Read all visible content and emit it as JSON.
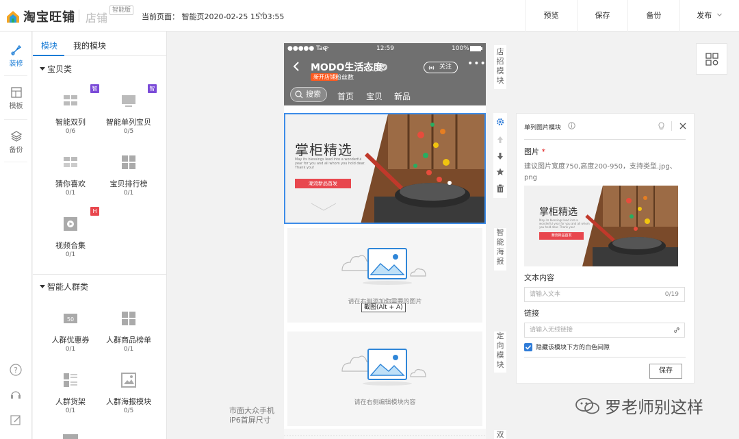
{
  "header": {
    "logo_text": "淘宝旺铺",
    "shop_text": "店铺",
    "edition_tag": "智能版",
    "current_page": "当前页面： 智能页2020-02-25 15:03:55",
    "preview_label": "预览",
    "save_label": "保存",
    "backup_label": "备份",
    "publish_label": "发布"
  },
  "left_nav": {
    "items": [
      {
        "label": "装修",
        "icon": "brush-icon",
        "active": true
      },
      {
        "label": "模板",
        "icon": "template-icon"
      },
      {
        "label": "备份",
        "icon": "layers-icon"
      }
    ]
  },
  "module_panel": {
    "tabs": [
      "模块",
      "我的模块"
    ],
    "active_tab": "模块",
    "sections": [
      {
        "title": "宝贝类",
        "modules": [
          {
            "name": "智能双列",
            "count": "0/6",
            "badge": "智"
          },
          {
            "name": "智能单列宝贝",
            "count": "0/5",
            "badge": "智"
          },
          {
            "name": "猜你喜欢",
            "count": "0/1"
          },
          {
            "name": "宝贝排行榜",
            "count": "0/1"
          },
          {
            "name": "视频合集",
            "count": "0/1",
            "badge": "H"
          }
        ]
      },
      {
        "title": "智能人群类",
        "modules": [
          {
            "name": "人群优惠券",
            "count": "0/1",
            "icon_text": "50"
          },
          {
            "name": "人群商品榜单",
            "count": "0/1"
          },
          {
            "name": "人群货架",
            "count": "0/1"
          },
          {
            "name": "人群海报模块",
            "count": "0/5"
          }
        ]
      }
    ]
  },
  "canvas": {
    "device_note_1": "市面大众手机",
    "device_note_2": "iP6首屏尺寸"
  },
  "phone": {
    "carrier": "●●●●● Tao",
    "time": "12:59",
    "battery": "100%",
    "shop_name": "MODO生活态度",
    "new_shop_tag": "新开店铺",
    "fans_label": "粉丝数",
    "follow_label": "关注",
    "search_label": "搜索",
    "nav": [
      "首页",
      "宝贝",
      "新品"
    ],
    "banner": {
      "title": "掌柜精选",
      "subtitle": "May its blessings lead into a wonderful year for you and all whom you hold dear. Thank you！",
      "button": "潮流新品首发"
    },
    "placeholder_1": "请在右侧添加你需要的图片",
    "tooltip": "截图(Alt + A)",
    "placeholder_2": "请在右侧编辑模块内容"
  },
  "side_labels": [
    "店招模块",
    "智能海报",
    "定向模块",
    "双"
  ],
  "properties": {
    "title": "单列图片模块",
    "image_label": "图片",
    "image_hint": "建议图片宽度750,高度200-950，支持类型.jpg、png",
    "text_label": "文本内容",
    "text_placeholder": "请输入文本",
    "text_count": "0/19",
    "link_label": "链接",
    "link_placeholder": "请输入无线链接",
    "hide_gap_label": "隐藏该模块下方的白色间隙",
    "save_label": "保存",
    "banner_title": "掌柜精选",
    "banner_sub": "May its blessings lead into a wonderful year for you and all whom you hold dear. Thank you！",
    "banner_button": "潮流新品首发"
  },
  "watermark": "罗老师别这样",
  "colors": {
    "accent": "#1a7cd6",
    "selected_border": "#3c8ce8",
    "badge_purple": "#7b4bd8",
    "badge_red": "#e8474e",
    "phone_header": "#707070",
    "checkbox": "#2f7cd8"
  }
}
